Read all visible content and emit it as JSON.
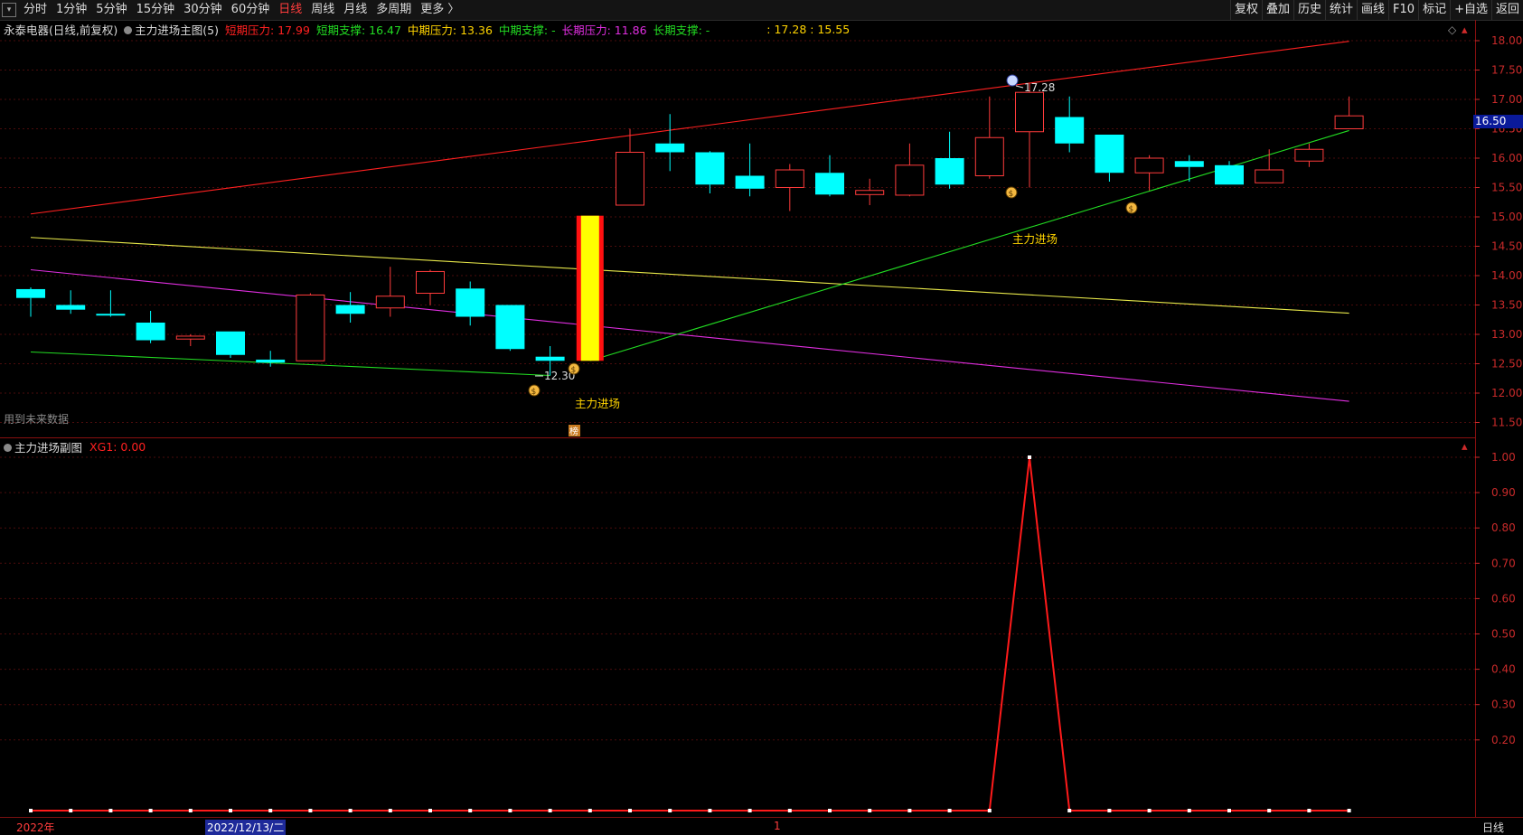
{
  "toolbar": {
    "periods": [
      "分时",
      "1分钟",
      "5分钟",
      "15分钟",
      "30分钟",
      "60分钟",
      "日线",
      "周线",
      "月线",
      "多周期",
      "更多 〉"
    ],
    "active_period": "日线",
    "right_buttons": [
      "复权",
      "叠加",
      "历史",
      "统计",
      "画线",
      "F10",
      "标记",
      "+自选",
      "返回"
    ]
  },
  "main_panel": {
    "stock": "永泰电器(日线,前复权)",
    "indicator": "主力进场主图(5)",
    "short_pressure": "短期压力: 17.99",
    "short_support": "短期支撑: 16.47",
    "mid_pressure": "中期压力: 13.36",
    "mid_support": "中期支撑: -",
    "long_pressure": "长期压力: 11.86",
    "long_support": "长期支撑: -",
    "extra": ": 17.28 : 15.55",
    "future_note": "用到未来数据",
    "label_entry": "主力进场",
    "high_label": "17.28",
    "low_label": "12.30",
    "bang_label": "榜",
    "y_ticks": [
      "18.00",
      "17.50",
      "17.00",
      "16.50",
      "16.00",
      "15.50",
      "15.00",
      "14.50",
      "14.00",
      "13.50",
      "13.00",
      "12.50",
      "12.00",
      "11.50"
    ],
    "current_price": "16.50"
  },
  "sub_panel": {
    "title": "主力进场副图",
    "xg": "XG1: 0.00",
    "y_ticks": [
      "1.00",
      "0.90",
      "0.80",
      "0.70",
      "0.60",
      "0.50",
      "0.40",
      "0.30",
      "0.20"
    ]
  },
  "bottom": {
    "year": "2022年",
    "date": "2022/12/13/二",
    "mark": "1",
    "period": "日线"
  },
  "chart_data": {
    "type": "candlestick",
    "price_range": [
      11.3,
      18.2
    ],
    "candles": [
      {
        "o": 13.77,
        "h": 13.8,
        "l": 13.3,
        "c": 13.62
      },
      {
        "o": 13.5,
        "h": 13.75,
        "l": 13.35,
        "c": 13.42
      },
      {
        "o": 13.35,
        "h": 13.75,
        "l": 13.3,
        "c": 13.32
      },
      {
        "o": 13.2,
        "h": 13.4,
        "l": 12.85,
        "c": 12.9
      },
      {
        "o": 12.92,
        "h": 13.0,
        "l": 12.8,
        "c": 12.97
      },
      {
        "o": 13.05,
        "h": 13.05,
        "l": 12.6,
        "c": 12.65
      },
      {
        "o": 12.57,
        "h": 12.72,
        "l": 12.45,
        "c": 12.52
      },
      {
        "o": 12.55,
        "h": 13.7,
        "l": 12.55,
        "c": 13.67
      },
      {
        "o": 13.5,
        "h": 13.72,
        "l": 13.2,
        "c": 13.35
      },
      {
        "o": 13.45,
        "h": 14.15,
        "l": 13.3,
        "c": 13.65
      },
      {
        "o": 13.7,
        "h": 14.1,
        "l": 13.5,
        "c": 14.07
      },
      {
        "o": 13.78,
        "h": 13.9,
        "l": 13.15,
        "c": 13.3
      },
      {
        "o": 13.5,
        "h": 13.5,
        "l": 12.72,
        "c": 12.75
      },
      {
        "o": 12.62,
        "h": 12.8,
        "l": 12.3,
        "c": 12.55
      },
      {
        "o": 12.55,
        "h": 15.02,
        "l": 12.55,
        "c": 15.02
      },
      {
        "o": 15.2,
        "h": 16.5,
        "l": 15.2,
        "c": 16.1
      },
      {
        "o": 16.25,
        "h": 16.75,
        "l": 15.78,
        "c": 16.1
      },
      {
        "o": 16.1,
        "h": 16.12,
        "l": 15.4,
        "c": 15.55
      },
      {
        "o": 15.7,
        "h": 16.25,
        "l": 15.35,
        "c": 15.48
      },
      {
        "o": 15.5,
        "h": 15.9,
        "l": 15.1,
        "c": 15.8
      },
      {
        "o": 15.75,
        "h": 16.05,
        "l": 15.35,
        "c": 15.38
      },
      {
        "o": 15.38,
        "h": 15.65,
        "l": 15.2,
        "c": 15.45
      },
      {
        "o": 15.37,
        "h": 16.25,
        "l": 15.35,
        "c": 15.88
      },
      {
        "o": 16.0,
        "h": 16.45,
        "l": 15.48,
        "c": 15.55
      },
      {
        "o": 15.7,
        "h": 17.05,
        "l": 15.65,
        "c": 16.35
      },
      {
        "o": 16.45,
        "h": 17.28,
        "l": 15.5,
        "c": 17.12
      },
      {
        "o": 16.7,
        "h": 17.05,
        "l": 16.1,
        "c": 16.25
      },
      {
        "o": 16.4,
        "h": 16.4,
        "l": 15.6,
        "c": 15.75
      },
      {
        "o": 15.75,
        "h": 16.05,
        "l": 15.45,
        "c": 16.0
      },
      {
        "o": 15.95,
        "h": 16.05,
        "l": 15.6,
        "c": 15.85
      },
      {
        "o": 15.88,
        "h": 15.95,
        "l": 15.55,
        "c": 15.55
      },
      {
        "o": 15.58,
        "h": 16.15,
        "l": 15.58,
        "c": 15.8
      },
      {
        "o": 15.95,
        "h": 16.25,
        "l": 15.85,
        "c": 16.15
      },
      {
        "o": 16.5,
        "h": 17.05,
        "l": 16.5,
        "c": 16.72
      }
    ],
    "lines": [
      {
        "name": "短期压力",
        "color": "#ff2020",
        "from": [
          0,
          15.05
        ],
        "to": [
          33,
          17.99
        ]
      },
      {
        "name": "中期压力",
        "color": "#e8e84a",
        "from": [
          0,
          14.65
        ],
        "to": [
          33,
          13.36
        ]
      },
      {
        "name": "长期压力",
        "color": "#e02ee0",
        "from": [
          0,
          14.1
        ],
        "to": [
          33,
          11.86
        ]
      },
      {
        "name": "支撑1",
        "color": "#22dd22",
        "from": [
          0,
          12.7
        ],
        "to": [
          13,
          12.3
        ]
      },
      {
        "name": "支撑2",
        "color": "#22dd22",
        "from": [
          14,
          12.55
        ],
        "to": [
          33,
          16.47
        ]
      }
    ],
    "signal": {
      "values": [
        0,
        0,
        0,
        0,
        0,
        0,
        0,
        0,
        0,
        0,
        0,
        0,
        0,
        0,
        0,
        0,
        0,
        0,
        0,
        0,
        0,
        0,
        0,
        0,
        0,
        1,
        0,
        0,
        0,
        0,
        0,
        0,
        0,
        0
      ],
      "ylim": [
        0,
        1.02
      ]
    }
  }
}
